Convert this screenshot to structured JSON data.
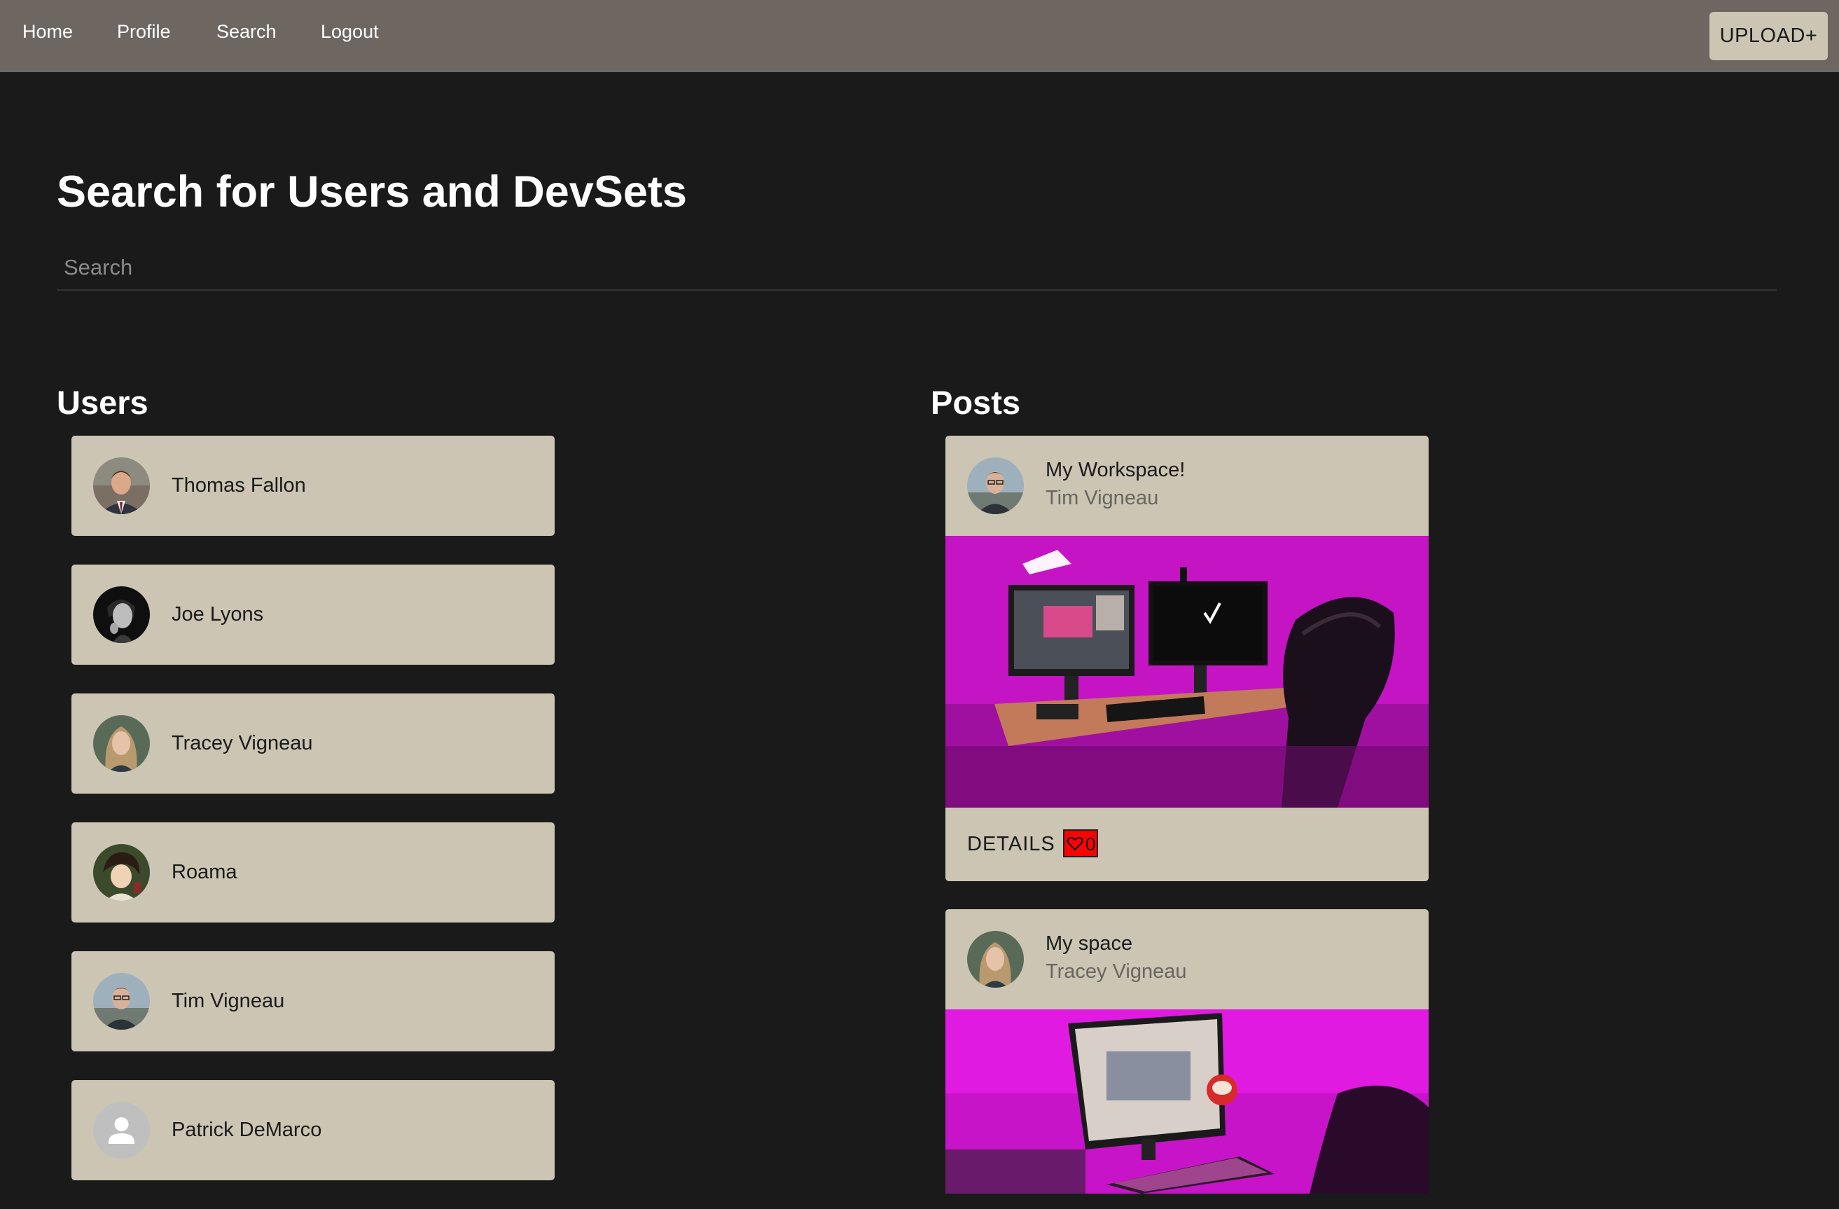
{
  "nav": {
    "links": [
      "Home",
      "Profile",
      "Search",
      "Logout"
    ],
    "upload_label": "UPLOAD+"
  },
  "page": {
    "title": "Search for Users and DevSets",
    "search_placeholder": "Search",
    "search_value": ""
  },
  "users": {
    "heading": "Users",
    "items": [
      {
        "name": "Thomas Fallon",
        "avatar": "photo"
      },
      {
        "name": "Joe Lyons",
        "avatar": "photo"
      },
      {
        "name": "Tracey Vigneau",
        "avatar": "photo"
      },
      {
        "name": "Roama",
        "avatar": "photo"
      },
      {
        "name": "Tim Vigneau",
        "avatar": "photo"
      },
      {
        "name": "Patrick DeMarco",
        "avatar": "default-person-icon"
      }
    ]
  },
  "posts": {
    "heading": "Posts",
    "items": [
      {
        "title": "My Workspace!",
        "author": "Tim Vigneau",
        "details_label": "DETAILS",
        "likes": "0"
      },
      {
        "title": "My space",
        "author": "Tracey Vigneau"
      }
    ]
  },
  "colors": {
    "background": "#1a1a1a",
    "navbar": "#6d6661",
    "card": "#ccc5b4",
    "like_button": "#ff0000",
    "photo_accent": "#d00fd0"
  }
}
